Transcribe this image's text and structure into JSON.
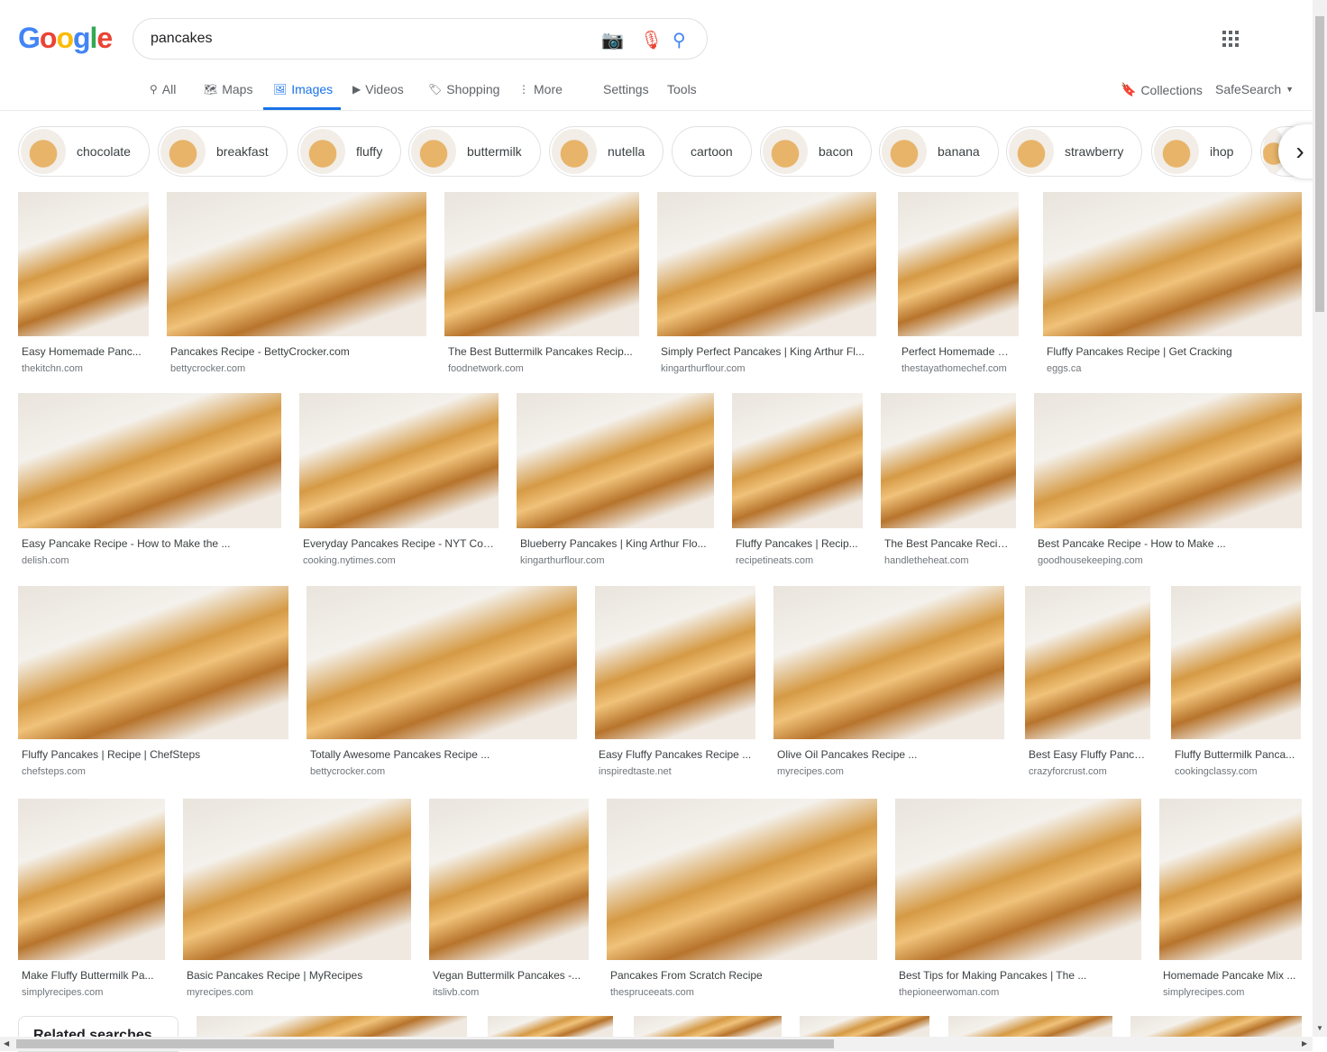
{
  "logo": "Google",
  "search": {
    "query": "pancakes"
  },
  "nav": [
    {
      "label": "All",
      "icon": "search-icon"
    },
    {
      "label": "Maps",
      "icon": "map-icon"
    },
    {
      "label": "Images",
      "icon": "image-icon",
      "active": true
    },
    {
      "label": "Videos",
      "icon": "play-icon"
    },
    {
      "label": "Shopping",
      "icon": "tag-icon"
    },
    {
      "label": "More",
      "icon": "dots-vertical-icon"
    },
    {
      "label": "Settings"
    },
    {
      "label": "Tools"
    }
  ],
  "right": {
    "collections": "Collections",
    "safesearch": "SafeSearch"
  },
  "chips": [
    "chocolate",
    "breakfast",
    "fluffy",
    "buttermilk",
    "nutella",
    "cartoon",
    "bacon",
    "banana",
    "strawberry",
    "ihop"
  ],
  "rows": [
    [
      {
        "title": "Easy Homemade Panc...",
        "site": "thekitchn.com"
      },
      {
        "title": "Pancakes Recipe - BettyCrocker.com",
        "site": "bettycrocker.com"
      },
      {
        "title": "The Best Buttermilk Pancakes Recip...",
        "site": "foodnetwork.com"
      },
      {
        "title": "Simply Perfect Pancakes | King Arthur Fl...",
        "site": "kingarthurflour.com"
      },
      {
        "title": "Perfect Homemade Pa...",
        "site": "thestayathomechef.com"
      },
      {
        "title": "Fluffy Pancakes Recipe | Get Cracking",
        "site": "eggs.ca"
      }
    ],
    [
      {
        "title": "Easy Pancake Recipe - How to Make the ...",
        "site": "delish.com"
      },
      {
        "title": "Everyday Pancakes Recipe - NYT Coo...",
        "site": "cooking.nytimes.com"
      },
      {
        "title": "Blueberry Pancakes | King Arthur Flo...",
        "site": "kingarthurflour.com"
      },
      {
        "title": "Fluffy Pancakes | Recip...",
        "site": "recipetineats.com"
      },
      {
        "title": "The Best Pancake Recip...",
        "site": "handletheheat.com"
      },
      {
        "title": "Best Pancake Recipe - How to Make ...",
        "site": "goodhousekeeping.com"
      }
    ],
    [
      {
        "title": "Fluffy Pancakes | Recipe | ChefSteps",
        "site": "chefsteps.com"
      },
      {
        "title": "Totally Awesome Pancakes Recipe ...",
        "site": "bettycrocker.com"
      },
      {
        "title": "Easy Fluffy Pancakes Recipe ...",
        "site": "inspiredtaste.net"
      },
      {
        "title": "Olive Oil Pancakes Recipe ...",
        "site": "myrecipes.com"
      },
      {
        "title": "Best Easy Fluffy Panca...",
        "site": "crazyforcrust.com"
      },
      {
        "title": "Fluffy Buttermilk Panca...",
        "site": "cookingclassy.com"
      }
    ],
    [
      {
        "title": "Make Fluffy Buttermilk Pa...",
        "site": "simplyrecipes.com"
      },
      {
        "title": "Basic Pancakes Recipe | MyRecipes",
        "site": "myrecipes.com"
      },
      {
        "title": "Vegan Buttermilk Pancakes -...",
        "site": "itslivb.com"
      },
      {
        "title": "Pancakes From Scratch Recipe",
        "site": "thespruceeats.com"
      },
      {
        "title": "Best Tips for Making Pancakes | The ...",
        "site": "thepioneerwoman.com"
      },
      {
        "title": "Homemade Pancake Mix ...",
        "site": "simplyrecipes.com"
      }
    ]
  ],
  "related": "Related searches",
  "colors": {
    "accent": "#1a73e8"
  }
}
